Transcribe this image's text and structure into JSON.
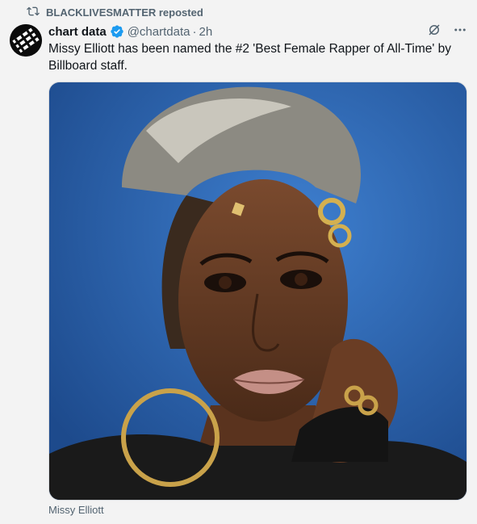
{
  "repost": {
    "label": "BLACKLIVESMATTER reposted"
  },
  "author": {
    "name": "chart data",
    "handle": "@chartdata",
    "separator": "·",
    "time": "2h"
  },
  "tweet": {
    "text": "Missy Elliott has been named the #2 'Best Female Rapper of All-Time' by Billboard staff."
  },
  "media": {
    "caption": "Missy Elliott"
  },
  "colors": {
    "verified": "#1d9bf0",
    "muted": "#536471",
    "background": "#f3f3f3"
  },
  "icons": [
    "repost-icon",
    "verified-badge-icon",
    "grok-icon",
    "more-icon"
  ]
}
